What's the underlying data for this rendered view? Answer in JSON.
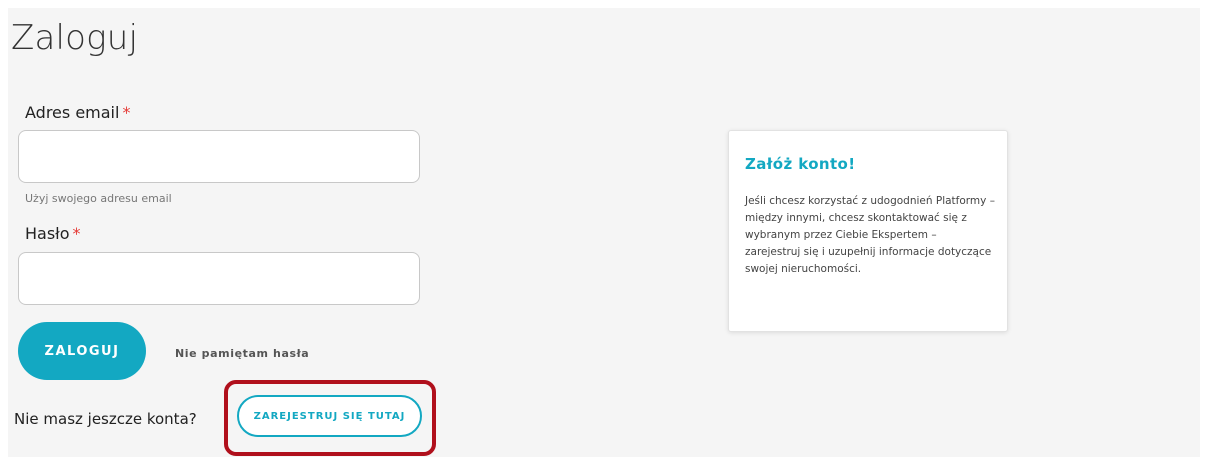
{
  "page": {
    "title": "Zaloguj"
  },
  "form": {
    "email_label": "Adres email",
    "required_mark": "*",
    "email_value": "",
    "email_hint": "Użyj swojego adresu email",
    "password_label": "Hasło",
    "password_value": "",
    "login_button": "ZALOGUJ",
    "forgot_link": "Nie pamiętam hasła"
  },
  "register": {
    "prompt": "Nie masz jeszcze konta?",
    "button": "ZAREJESTRUJ SIĘ TUTAJ"
  },
  "info_card": {
    "title": "Załóż konto!",
    "text": "Jeśli chcesz korzystać z udogodnień Platformy – między innymi, chcesz skontaktować się z wybranym przez Ciebie Ekspertem – zarejestruj się i uzupełnij informacje dotyczące swojej nieruchomości."
  },
  "colors": {
    "accent": "#13a8c2",
    "required": "#e53935",
    "highlight": "#b0101c",
    "background": "#f5f5f5"
  }
}
